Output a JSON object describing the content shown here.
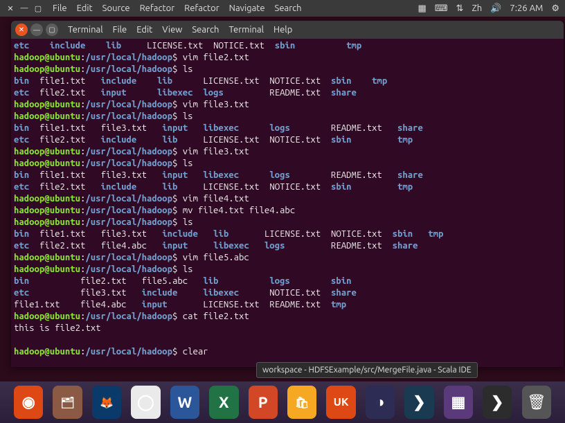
{
  "desktop_menu": {
    "file": "File",
    "edit": "Edit",
    "source": "Source",
    "refactor": "Refactor",
    "refactor2": "Refactor",
    "navigate": "Navigate",
    "search": "Search",
    "lang": "Zh",
    "time": "7:26 AM"
  },
  "term_menu": {
    "terminal": "Terminal",
    "file": "File",
    "edit": "Edit",
    "view": "View",
    "search": "Search",
    "terminal2": "Terminal",
    "help": "Help"
  },
  "prompt": {
    "user": "hadoop@ubuntu",
    "path": "/usr/local/hadoop",
    "sep": ":",
    "sym": "$"
  },
  "lines": [
    {
      "type": "ls",
      "items": [
        [
          "etc",
          "blue",
          "0"
        ],
        [
          "include",
          "blue",
          "7"
        ],
        [
          "lib",
          "blue",
          "18"
        ],
        [
          "LICENSE.txt",
          "white",
          "26"
        ],
        [
          "NOTICE.txt",
          "white",
          "39"
        ],
        [
          "sbin",
          "blue",
          "51"
        ],
        [
          "tmp",
          "blue",
          "65"
        ]
      ]
    },
    {
      "type": "prompt",
      "cmd": "vim file2.txt"
    },
    {
      "type": "prompt",
      "cmd": "ls"
    },
    {
      "type": "ls",
      "items": [
        [
          "bin",
          "blue",
          "0"
        ],
        [
          "file1.txt",
          "white",
          "5"
        ],
        [
          "include",
          "blue",
          "17"
        ],
        [
          "lib",
          "blue",
          "28"
        ],
        [
          "LICENSE.txt",
          "white",
          "37"
        ],
        [
          "NOTICE.txt",
          "white",
          "50"
        ],
        [
          "sbin",
          "blue",
          "62"
        ],
        [
          "tmp",
          "blue",
          "70"
        ]
      ]
    },
    {
      "type": "ls",
      "items": [
        [
          "etc",
          "blue",
          "0"
        ],
        [
          "file2.txt",
          "white",
          "5"
        ],
        [
          "input",
          "blue",
          "17"
        ],
        [
          "libexec",
          "blue",
          "28"
        ],
        [
          "logs",
          "blue",
          "37"
        ],
        [
          "README.txt",
          "white",
          "50"
        ],
        [
          "share",
          "blue",
          "62"
        ]
      ]
    },
    {
      "type": "prompt",
      "cmd": "vim file3.txt"
    },
    {
      "type": "prompt",
      "cmd": "ls"
    },
    {
      "type": "ls",
      "items": [
        [
          "bin",
          "blue",
          "0"
        ],
        [
          "file1.txt",
          "white",
          "5"
        ],
        [
          "file3.txt",
          "white",
          "17"
        ],
        [
          "input",
          "blue",
          "29"
        ],
        [
          "libexec",
          "blue",
          "37"
        ],
        [
          "logs",
          "blue",
          "50"
        ],
        [
          "README.txt",
          "white",
          "62"
        ],
        [
          "share",
          "blue",
          "75"
        ]
      ]
    },
    {
      "type": "ls",
      "items": [
        [
          "etc",
          "blue",
          "0"
        ],
        [
          "file2.txt",
          "white",
          "5"
        ],
        [
          "include",
          "blue",
          "17"
        ],
        [
          "lib",
          "blue",
          "29"
        ],
        [
          "LICENSE.txt",
          "white",
          "37"
        ],
        [
          "NOTICE.txt",
          "white",
          "50"
        ],
        [
          "sbin",
          "blue",
          "62"
        ],
        [
          "tmp",
          "blue",
          "75"
        ]
      ]
    },
    {
      "type": "prompt",
      "cmd": "vim file3.txt"
    },
    {
      "type": "prompt",
      "cmd": "ls"
    },
    {
      "type": "ls",
      "items": [
        [
          "bin",
          "blue",
          "0"
        ],
        [
          "file1.txt",
          "white",
          "5"
        ],
        [
          "file3.txt",
          "white",
          "17"
        ],
        [
          "input",
          "blue",
          "29"
        ],
        [
          "libexec",
          "blue",
          "37"
        ],
        [
          "logs",
          "blue",
          "50"
        ],
        [
          "README.txt",
          "white",
          "62"
        ],
        [
          "share",
          "blue",
          "75"
        ]
      ]
    },
    {
      "type": "ls",
      "items": [
        [
          "etc",
          "blue",
          "0"
        ],
        [
          "file2.txt",
          "white",
          "5"
        ],
        [
          "include",
          "blue",
          "17"
        ],
        [
          "lib",
          "blue",
          "29"
        ],
        [
          "LICENSE.txt",
          "white",
          "37"
        ],
        [
          "NOTICE.txt",
          "white",
          "50"
        ],
        [
          "sbin",
          "blue",
          "62"
        ],
        [
          "tmp",
          "blue",
          "75"
        ]
      ]
    },
    {
      "type": "prompt",
      "cmd": "vim file4.txt"
    },
    {
      "type": "prompt",
      "cmd": "mv file4.txt file4.abc"
    },
    {
      "type": "prompt",
      "cmd": "ls"
    },
    {
      "type": "ls",
      "items": [
        [
          "bin",
          "blue",
          "0"
        ],
        [
          "file1.txt",
          "white",
          "5"
        ],
        [
          "file3.txt",
          "white",
          "17"
        ],
        [
          "include",
          "blue",
          "29"
        ],
        [
          "lib",
          "blue",
          "39"
        ],
        [
          "LICENSE.txt",
          "white",
          "49"
        ],
        [
          "NOTICE.txt",
          "white",
          "62"
        ],
        [
          "sbin",
          "blue",
          "74"
        ],
        [
          "tmp",
          "blue",
          "81"
        ]
      ]
    },
    {
      "type": "ls",
      "items": [
        [
          "etc",
          "blue",
          "0"
        ],
        [
          "file2.txt",
          "white",
          "5"
        ],
        [
          "file4.abc",
          "white",
          "17"
        ],
        [
          "input",
          "blue",
          "29"
        ],
        [
          "libexec",
          "blue",
          "39"
        ],
        [
          "logs",
          "blue",
          "49"
        ],
        [
          "README.txt",
          "white",
          "62"
        ],
        [
          "share",
          "blue",
          "74"
        ]
      ]
    },
    {
      "type": "prompt",
      "cmd": "vim file5.abc"
    },
    {
      "type": "prompt",
      "cmd": "ls"
    },
    {
      "type": "ls",
      "items": [
        [
          "bin",
          "blue",
          "0"
        ],
        [
          "file2.txt",
          "white",
          "13"
        ],
        [
          "file5.abc",
          "white",
          "25"
        ],
        [
          "lib",
          "blue",
          "37"
        ],
        [
          "logs",
          "blue",
          "50"
        ],
        [
          "sbin",
          "blue",
          "62"
        ]
      ]
    },
    {
      "type": "ls",
      "items": [
        [
          "etc",
          "blue",
          "0"
        ],
        [
          "file3.txt",
          "white",
          "13"
        ],
        [
          "include",
          "blue",
          "25"
        ],
        [
          "libexec",
          "blue",
          "37"
        ],
        [
          "NOTICE.txt",
          "white",
          "50"
        ],
        [
          "share",
          "blue",
          "62"
        ]
      ]
    },
    {
      "type": "ls",
      "items": [
        [
          "file1.txt",
          "white",
          "0"
        ],
        [
          "file4.abc",
          "white",
          "13"
        ],
        [
          "input",
          "blue",
          "25"
        ],
        [
          "LICENSE.txt",
          "white",
          "37"
        ],
        [
          "README.txt",
          "white",
          "50"
        ],
        [
          "tmp",
          "blue",
          "62"
        ]
      ]
    },
    {
      "type": "prompt",
      "cmd": "cat file2.txt"
    },
    {
      "type": "text",
      "text": "this is file2.txt"
    },
    {
      "type": "text",
      "text": ""
    },
    {
      "type": "prompt",
      "cmd": "clear"
    }
  ],
  "tooltip": "workspace - HDFSExample/src/MergeFile.java - Scala IDE",
  "dock_items": [
    {
      "name": "launcher",
      "color": "#dd4814",
      "icon": "◉"
    },
    {
      "name": "files",
      "color": "#8a5a44",
      "icon": "🗂"
    },
    {
      "name": "firefox",
      "color": "#0a3a6a",
      "icon": "🦊"
    },
    {
      "name": "chromium",
      "color": "#eaeaea",
      "icon": "◯"
    },
    {
      "name": "word",
      "color": "#2b579a",
      "icon": "W"
    },
    {
      "name": "excel",
      "color": "#217346",
      "icon": "X"
    },
    {
      "name": "powerpoint",
      "color": "#d24726",
      "icon": "P"
    },
    {
      "name": "software",
      "color": "#f7a823",
      "icon": "🛍"
    },
    {
      "name": "ubuntu-kylin",
      "color": "#dd4814",
      "icon": "UK"
    },
    {
      "name": "eclipse",
      "color": "#2c2c54",
      "icon": "◑"
    },
    {
      "name": "ide-arrow",
      "color": "#1a3a52",
      "icon": "❯"
    },
    {
      "name": "apps",
      "color": "#5a3a7a",
      "icon": "▦"
    },
    {
      "name": "scala-ide",
      "color": "#2c2c2c",
      "icon": "❯"
    }
  ],
  "trash": {
    "icon": "🗑"
  }
}
